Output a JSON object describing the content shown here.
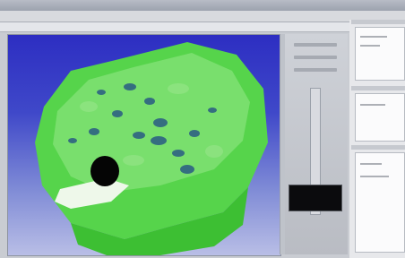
{
  "window": {},
  "viewport": {
    "background_top": "#2d2ec2",
    "background_bottom": "#b9bee6",
    "model_color": "#43c93b",
    "model_highlight": "#8be07e",
    "feature_color": "#22507a",
    "hole_color": "#050505"
  },
  "panels": {
    "swatch_color": "#0b0b0d"
  }
}
